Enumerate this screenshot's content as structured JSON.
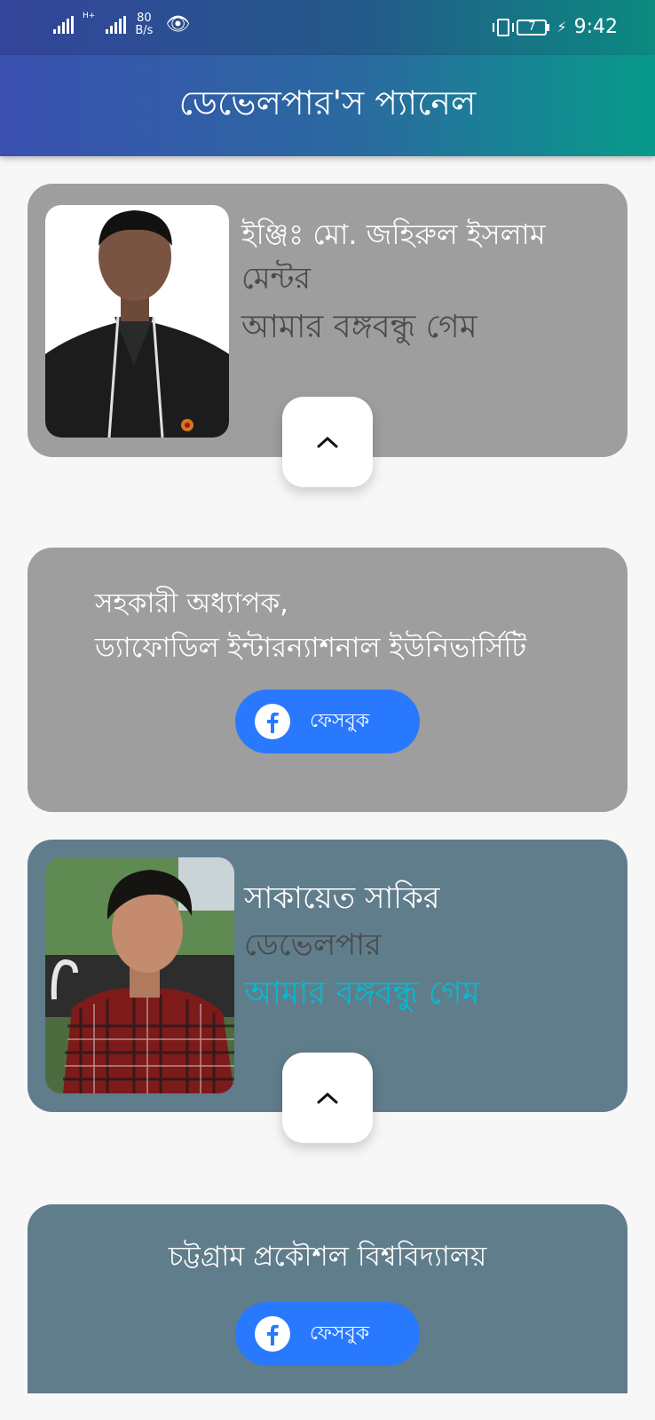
{
  "status_bar": {
    "network_speed_value": "80",
    "network_speed_unit": "B/s",
    "network_type": "H+",
    "battery_level": "7",
    "time": "9:42"
  },
  "app_bar": {
    "title": "ডেভেলপার'স প্যানেল"
  },
  "developers": [
    {
      "name": "ইঞ্জিঃ মো. জহিরুল ইসলাম",
      "role": "মেন্টর",
      "app_name": "আমার বঙ্গবন্ধু গেম",
      "app_name_color": "#4a4a4a",
      "card_color": "#9e9e9e",
      "details_line1": "সহকারী অধ্যাপক,",
      "details_line2": "ড্যাফোডিল ইন্টারন্যাশনাল ইউনিভার্সিটি",
      "facebook_label": "ফেসবুক"
    },
    {
      "name": "সাকায়েত সাকির",
      "role": "ডেভেলপার",
      "app_name": "আমার বঙ্গবন্ধু গেম",
      "app_name_color": "#00bcd4",
      "card_color": "#607d8b",
      "details_line1": "চট্টগ্রাম প্রকৌশল বিশ্ববিদ্যালয়",
      "facebook_label": "ফেসবুক"
    }
  ],
  "colors": {
    "facebook_button": "#2979ff",
    "appbar_start": "#3a4fb0",
    "appbar_end": "#079a8a"
  },
  "icons": {
    "toggle": "chevron-up-icon",
    "facebook": "facebook-icon"
  }
}
